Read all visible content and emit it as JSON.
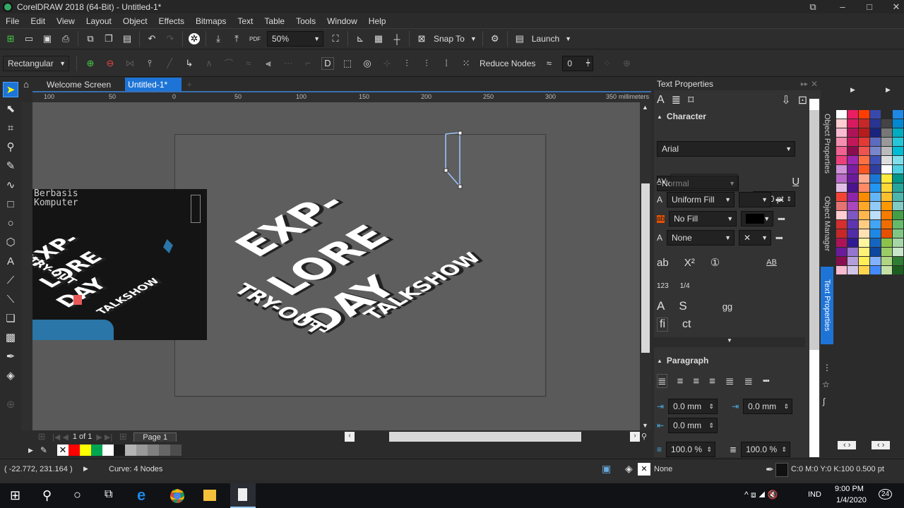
{
  "window": {
    "title": "CorelDRAW 2018 (64-Bit) - Untitled-1*"
  },
  "menu": [
    "File",
    "Edit",
    "View",
    "Layout",
    "Object",
    "Effects",
    "Bitmaps",
    "Text",
    "Table",
    "Tools",
    "Window",
    "Help"
  ],
  "toolbar": {
    "zoom": "50%",
    "snap_to": "Snap To",
    "launch": "Launch"
  },
  "propbar": {
    "node_type": "Rectangular",
    "reduce_nodes": "Reduce Nodes",
    "smoothing": "0"
  },
  "tabs": [
    {
      "label": "Welcome Screen"
    },
    {
      "label": "Untitled-1*"
    }
  ],
  "ruler": {
    "ticks": [
      "100",
      "50",
      "0",
      "50",
      "100",
      "150",
      "200",
      "250",
      "300",
      "350"
    ],
    "unit": "millimeters"
  },
  "artwork": {
    "main_lines": [
      "EXP-",
      "LORE",
      "DAY"
    ],
    "tryout": "TRY-OUT",
    "talkshow": "TALKSHOW",
    "thumb_caption": [
      "Berbasis",
      "Komputer"
    ],
    "thumb_lines": [
      "EXP-",
      "LORE",
      "DAY"
    ],
    "thumb_tryout": "TRY-OUT",
    "thumb_talkshow": "TALKSHOW"
  },
  "pagenav": {
    "count": "1 of 1",
    "page": "Page 1"
  },
  "doc_palette": [
    "#ff0000",
    "#ffff00",
    "#00a651",
    "#ffffff",
    "#1a1a1a",
    "#b3b3b3",
    "#999999",
    "#808080",
    "#666666",
    "#4d4d4d"
  ],
  "status": {
    "coords": "( -22.772, 231.164 )",
    "info": "Curve: 4 Nodes",
    "fill": "None",
    "outline": "C:0 M:0 Y:0 K:100  0.500 pt"
  },
  "taskbar": {
    "time": "9:00 PM",
    "date": "1/4/2020",
    "lang": "IND",
    "notif": "24"
  },
  "docker": {
    "title": "Text Properties",
    "character": "Character",
    "font": "Arial",
    "style": "Normal",
    "size": "12.0 pt",
    "text_fill": "Uniform Fill",
    "bg_fill": "No Fill",
    "outline": "None",
    "paragraph": "Paragraph",
    "indent_left": "0.0 mm",
    "indent_first": "0.0 mm",
    "indent_right": "0.0 mm",
    "line_spacing": "100.0 %",
    "char_spacing": "100.0 %"
  },
  "side_tabs": [
    "Object Properties",
    "Object Manager",
    "Text Properties"
  ],
  "palette_colors": [
    "#ffffff",
    "#e91e63",
    "#ff3d00",
    "#3949ab",
    "#2b2b2b",
    "#1e88e5",
    "#ffcdd2",
    "#d81b60",
    "#c62828",
    "#283593",
    "#444",
    "#0288d1",
    "#f8bbd0",
    "#ad1457",
    "#b71c1c",
    "#1a237e",
    "#777",
    "#00acc1",
    "#f48fb1",
    "#c2185b",
    "#e53935",
    "#5c6bc0",
    "#999",
    "#26c6da",
    "#f06292",
    "#880e4f",
    "#ef5350",
    "#7986cb",
    "#bbb",
    "#00bcd4",
    "#ec407a",
    "#9c27b0",
    "#ff7043",
    "#3f51b5",
    "#ddd",
    "#80deea",
    "#ce93d8",
    "#7b1fa2",
    "#ff5722",
    "#303f9f",
    "#fff",
    "#4dd0e1",
    "#ba68c8",
    "#6a1b9a",
    "#ffab91",
    "#1976d2",
    "#ffeb3b",
    "#009688",
    "#e1bee7",
    "#4a148c",
    "#ff8a65",
    "#2196f3",
    "#fdd835",
    "#26a69a",
    "#f44336",
    "#8e24aa",
    "#fb8c00",
    "#64b5f6",
    "#fbc02d",
    "#4db6ac",
    "#e57373",
    "#ab47bc",
    "#ffa726",
    "#90caf9",
    "#ff9800",
    "#80cbc4",
    "#ffcdd2",
    "#7e57c2",
    "#ffb74d",
    "#bbdefb",
    "#f57c00",
    "#43a047",
    "#d32f2f",
    "#5e35b1",
    "#ffcc80",
    "#42a5f5",
    "#ef6c00",
    "#66bb6a",
    "#c62828",
    "#512da8",
    "#ffe0b2",
    "#1e88e5",
    "#e65100",
    "#81c784",
    "#ad1457",
    "#311b92",
    "#fff59d",
    "#1565c0",
    "#8bc34a",
    "#a5d6a7",
    "#6a1b9a",
    "#9575cd",
    "#fff176",
    "#0d47a1",
    "#9ccc65",
    "#c8e6c9",
    "#880e4f",
    "#b39ddb",
    "#ffee58",
    "#82b1ff",
    "#aed581",
    "#2e7d32",
    "#f8bbd0",
    "#d1c4e9",
    "#ffd54f",
    "#448aff",
    "#c5e1a5",
    "#1b5e20"
  ]
}
